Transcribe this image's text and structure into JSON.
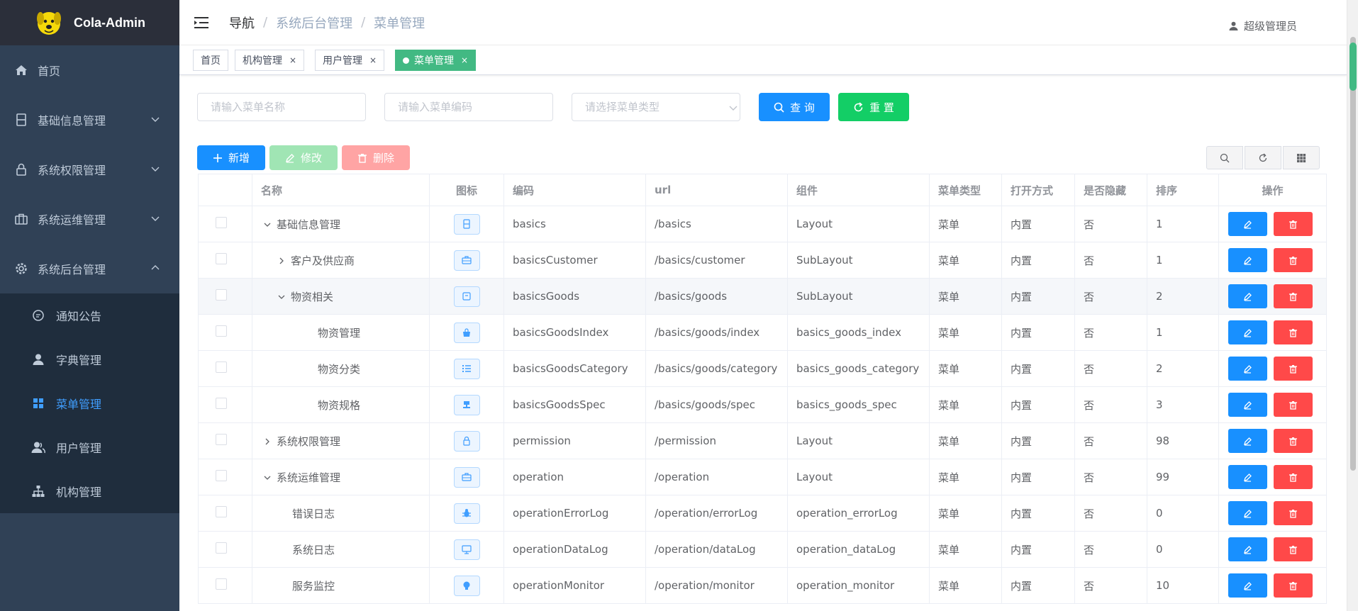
{
  "app": {
    "name": "Cola-Admin"
  },
  "sidebar": {
    "items": [
      {
        "label": "首页",
        "icon": "home-icon"
      },
      {
        "label": "基础信息管理",
        "icon": "document-icon"
      },
      {
        "label": "系统权限管理",
        "icon": "lock-icon"
      },
      {
        "label": "系统运维管理",
        "icon": "briefcase-icon"
      },
      {
        "label": "系统后台管理",
        "icon": "gear-icon"
      }
    ],
    "sub_items": [
      {
        "label": "通知公告",
        "icon": "chat-icon"
      },
      {
        "label": "字典管理",
        "icon": "user-icon"
      },
      {
        "label": "菜单管理",
        "icon": "grid-icon",
        "active": true
      },
      {
        "label": "用户管理",
        "icon": "users-icon"
      },
      {
        "label": "机构管理",
        "icon": "org-icon"
      }
    ]
  },
  "header": {
    "breadcrumb": [
      "导航",
      "系统后台管理",
      "菜单管理"
    ],
    "user": "超级管理员"
  },
  "tags": [
    {
      "label": "首页"
    },
    {
      "label": "机构管理",
      "close": "×"
    },
    {
      "label": "用户管理",
      "close": "×"
    },
    {
      "label": "菜单管理",
      "close": "×",
      "active": true
    }
  ],
  "query": {
    "name_placeholder": "请输入菜单名称",
    "code_placeholder": "请输入菜单编码",
    "type_placeholder": "请选择菜单类型",
    "search_label": "查 询",
    "reset_label": "重 置"
  },
  "toolbar": {
    "add": "新增",
    "edit": "修改",
    "delete": "删除"
  },
  "colors": {
    "primary": "#1890ff",
    "success": "#13ce66",
    "danger": "#ff4949",
    "sidebar": "#304156",
    "active_tag": "#42b983"
  },
  "table": {
    "headers": [
      "名称",
      "图标",
      "编码",
      "url",
      "组件",
      "菜单类型",
      "打开方式",
      "是否隐藏",
      "排序",
      "操作"
    ],
    "rows": [
      {
        "name": "基础信息管理",
        "level": 0,
        "expander": "down",
        "icon": "document-icon",
        "code": "basics",
        "url": "/basics",
        "component": "Layout",
        "type": "菜单",
        "open": "内置",
        "hidden": "否",
        "sort": "1"
      },
      {
        "name": "客户及供应商",
        "level": 1,
        "expander": "right",
        "icon": "briefcase-icon",
        "code": "basicsCustomer",
        "url": "/basics/customer",
        "component": "SubLayout",
        "type": "菜单",
        "open": "内置",
        "hidden": "否",
        "sort": "1"
      },
      {
        "name": "物资相关",
        "level": 1,
        "expander": "down",
        "icon": "box-icon",
        "code": "basicsGoods",
        "url": "/basics/goods",
        "component": "SubLayout",
        "type": "菜单",
        "open": "内置",
        "hidden": "否",
        "sort": "2",
        "highlight": true
      },
      {
        "name": "物资管理",
        "level": 2,
        "expander": "none",
        "icon": "bag-icon",
        "code": "basicsGoodsIndex",
        "url": "/basics/goods/index",
        "component": "basics_goods_index",
        "type": "菜单",
        "open": "内置",
        "hidden": "否",
        "sort": "1"
      },
      {
        "name": "物资分类",
        "level": 2,
        "expander": "none",
        "icon": "list-icon",
        "code": "basicsGoodsCategory",
        "url": "/basics/goods/category",
        "component": "basics_goods_category",
        "type": "菜单",
        "open": "内置",
        "hidden": "否",
        "sort": "2"
      },
      {
        "name": "物资规格",
        "level": 2,
        "expander": "none",
        "icon": "stamp-icon",
        "code": "basicsGoodsSpec",
        "url": "/basics/goods/spec",
        "component": "basics_goods_spec",
        "type": "菜单",
        "open": "内置",
        "hidden": "否",
        "sort": "3"
      },
      {
        "name": "系统权限管理",
        "level": 0,
        "expander": "right",
        "icon": "lock-icon",
        "code": "permission",
        "url": "/permission",
        "component": "Layout",
        "type": "菜单",
        "open": "内置",
        "hidden": "否",
        "sort": "98"
      },
      {
        "name": "系统运维管理",
        "level": 0,
        "expander": "down",
        "icon": "briefcase-icon",
        "code": "operation",
        "url": "/operation",
        "component": "Layout",
        "type": "菜单",
        "open": "内置",
        "hidden": "否",
        "sort": "99"
      },
      {
        "name": "错误日志",
        "level": 1,
        "expander": "none",
        "icon": "bug-icon",
        "code": "operationErrorLog",
        "url": "/operation/errorLog",
        "component": "operation_errorLog",
        "type": "菜单",
        "open": "内置",
        "hidden": "否",
        "sort": "0"
      },
      {
        "name": "系统日志",
        "level": 1,
        "expander": "none",
        "icon": "monitor-icon",
        "code": "operationDataLog",
        "url": "/operation/dataLog",
        "component": "operation_dataLog",
        "type": "菜单",
        "open": "内置",
        "hidden": "否",
        "sort": "0"
      },
      {
        "name": "服务监控",
        "level": 1,
        "expander": "none",
        "icon": "bulb-icon",
        "code": "operationMonitor",
        "url": "/operation/monitor",
        "component": "operation_monitor",
        "type": "菜单",
        "open": "内置",
        "hidden": "否",
        "sort": "10"
      }
    ]
  }
}
